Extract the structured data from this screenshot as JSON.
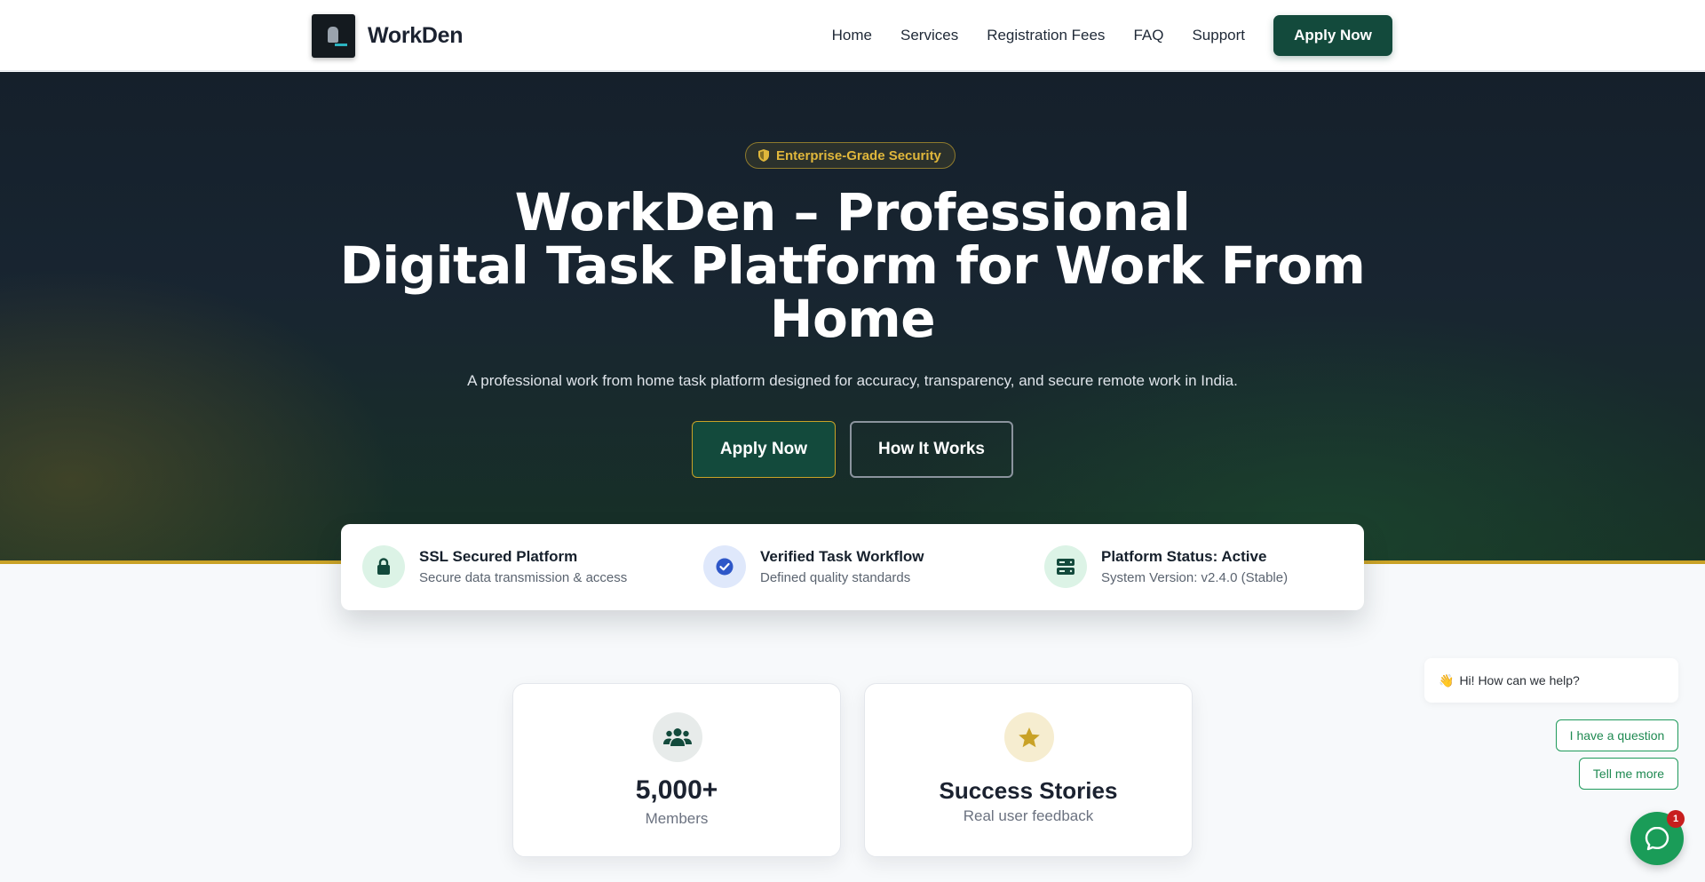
{
  "header": {
    "brand": "WorkDen",
    "nav": [
      "Home",
      "Services",
      "Registration Fees",
      "FAQ",
      "Support"
    ],
    "cta": "Apply Now"
  },
  "hero": {
    "badge": "Enterprise-Grade Security",
    "title_line1": "WorkDen – Professional",
    "title_line2": "Digital Task Platform for Work From",
    "title_line3": "Home",
    "subtitle": "A professional work from home task platform designed for accuracy, transparency, and secure remote work in India.",
    "primary_button": "Apply Now",
    "secondary_button": "How It Works"
  },
  "trust": [
    {
      "title": "SSL Secured Platform",
      "desc": "Secure data transmission & access",
      "icon": "lock-icon"
    },
    {
      "title": "Verified Task Workflow",
      "desc": "Defined quality standards",
      "icon": "check-badge-icon"
    },
    {
      "title": "Platform Status: Active",
      "desc": "System Version: v2.4.0 (Stable)",
      "icon": "server-icon"
    }
  ],
  "stats": [
    {
      "value": "5,000+",
      "label": "Members",
      "icon": "users-icon"
    },
    {
      "value": "Success Stories",
      "label": "Real user feedback",
      "icon": "star-icon"
    }
  ],
  "chat": {
    "greeting": "Hi! How can we help?",
    "options": [
      "I have a question",
      "Tell me more"
    ],
    "unread": "1"
  },
  "colors": {
    "brand_green": "#134a3c",
    "gold": "#c9a227",
    "chat_green": "#1a9c58"
  }
}
